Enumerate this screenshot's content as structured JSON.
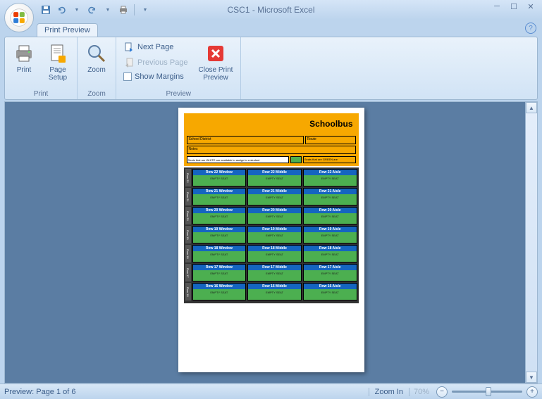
{
  "window": {
    "title": "CSC1 - Microsoft Excel"
  },
  "tab": {
    "label": "Print Preview"
  },
  "ribbon": {
    "print": {
      "group_label": "Print",
      "print_label": "Print",
      "page_setup_label": "Page\nSetup"
    },
    "zoom": {
      "group_label": "Zoom",
      "zoom_label": "Zoom"
    },
    "preview": {
      "group_label": "Preview",
      "next_page": "Next Page",
      "previous_page": "Previous Page",
      "show_margins": "Show Margins",
      "close_label": "Close Print\nPreview"
    }
  },
  "doc": {
    "title": "Schoolbus",
    "field1": "School District",
    "field2": "Route",
    "field3": "Notes",
    "legend_white": "Seats that are WHITE are available to assign to a student",
    "legend_green": "Seats that are GREEN are",
    "rows": [
      {
        "label": "Row 22",
        "seats": [
          "Row 22 Window",
          "Row 22 Middle",
          "Row 22 Aisle"
        ]
      },
      {
        "label": "Row 21",
        "seats": [
          "Row 21 Window",
          "Row 21 Middle",
          "Row 21 Aisle"
        ]
      },
      {
        "label": "Row 20",
        "seats": [
          "Row 20 Window",
          "Row 20 Middle",
          "Row 20 Aisle"
        ]
      },
      {
        "label": "Row 19",
        "seats": [
          "Row 19 Window",
          "Row 19 Middle",
          "Row 19 Aisle"
        ]
      },
      {
        "label": "Row 18",
        "seats": [
          "Row 18 Window",
          "Row 18 Middle",
          "Row 18 Aisle"
        ]
      },
      {
        "label": "Row 17",
        "seats": [
          "Row 17 Window",
          "Row 17 Middle",
          "Row 17 Aisle"
        ]
      },
      {
        "label": "Row 16",
        "seats": [
          "Row 16 Window",
          "Row 16 Middle",
          "Row 16 Aisle"
        ]
      }
    ],
    "seat_body": "EMPTY SEAT"
  },
  "status": {
    "left": "Preview: Page 1 of 6",
    "zoom_label": "Zoom In",
    "zoom_pct": "70%"
  }
}
